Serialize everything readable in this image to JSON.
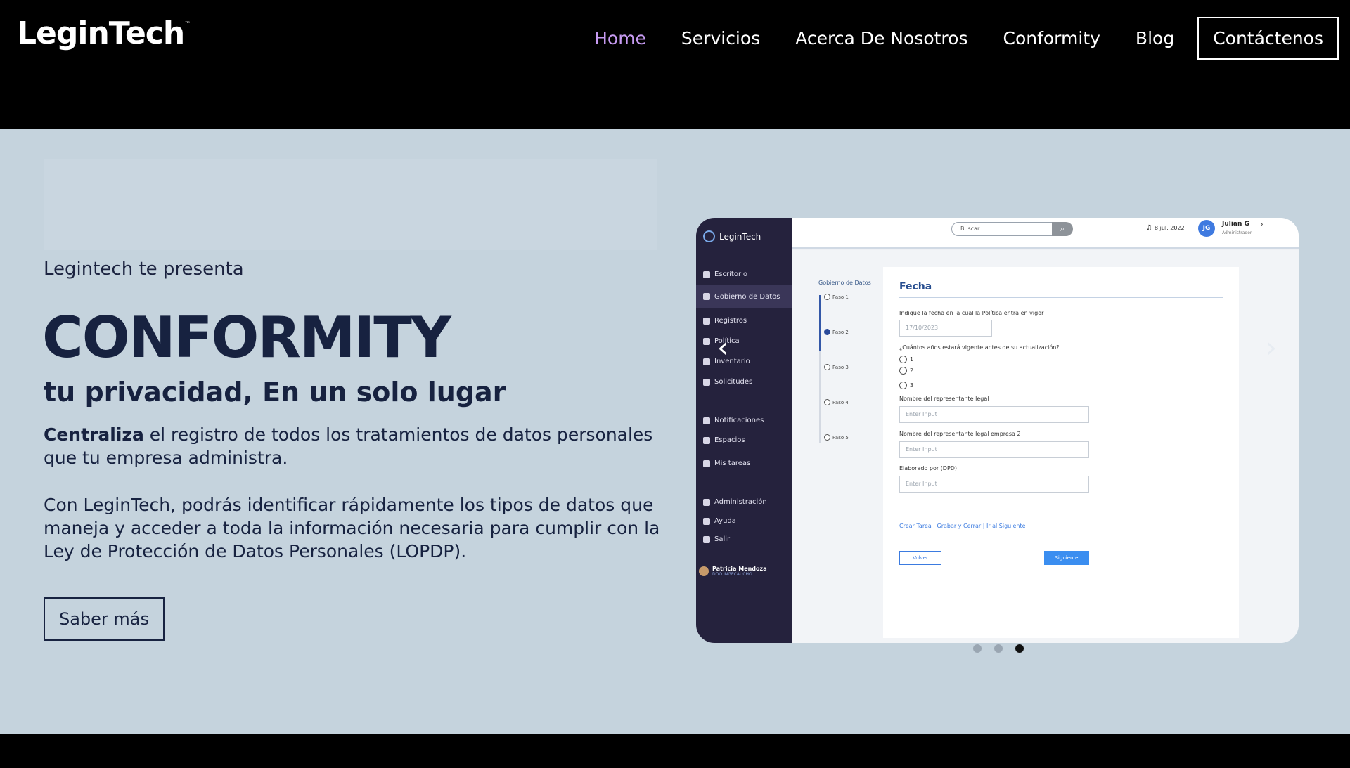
{
  "brand": {
    "logo_text": "LeginTech",
    "logo_mark": "™"
  },
  "nav": {
    "items": [
      {
        "label": "Home",
        "active": true
      },
      {
        "label": "Servicios",
        "active": false
      },
      {
        "label": "Acerca De Nosotros",
        "active": false
      },
      {
        "label": "Conformity",
        "active": false
      },
      {
        "label": "Blog",
        "active": false
      }
    ],
    "contact_label": "Contáctenos",
    "active_color": "#c79bf2"
  },
  "hero": {
    "intro": "Legintech te presenta",
    "title": "CONFORMITY",
    "subtitle_regular": "tu privacidad, ",
    "subtitle_bold": "En un solo lugar",
    "para1_bold": "Centraliza",
    "para1_rest": " el registro de todos los tratamientos de datos personales que tu empresa administra.",
    "para2": "Con LeginTech, podrás identificar rápidamente los tipos de datos que maneja y acceder a toda la información necesaria para cumplir con la Ley de Protección de Datos Personales (LOPDP).",
    "button_label": "Saber más",
    "background_color": "#c5d3dd",
    "text_color": "#172240"
  },
  "carousel": {
    "slide_count": 3,
    "active_index": 2,
    "prev_icon": "chevron-left-icon",
    "next_icon": "chevron-right-icon",
    "prev_glyph": "‹",
    "next_glyph": "›"
  },
  "mock_app": {
    "sidebar": {
      "logo": "LeginTech",
      "items": [
        {
          "label": "Escritorio",
          "icon": "desk-icon"
        },
        {
          "label": "Gobierno de Datos",
          "icon": "org-icon",
          "selected": true
        },
        {
          "label": "Registros",
          "icon": "file-icon"
        },
        {
          "label": "Política",
          "icon": "check-icon"
        },
        {
          "label": "Inventario",
          "icon": "inventory-icon"
        },
        {
          "label": "Solicitudes",
          "icon": "list-icon"
        },
        {
          "label": "Notificaciones",
          "icon": "bell-icon"
        },
        {
          "label": "Espacios",
          "icon": "org-icon"
        },
        {
          "label": "Mis tareas",
          "icon": "file-icon"
        },
        {
          "label": "Administración",
          "icon": "gear-icon"
        },
        {
          "label": "Ayuda",
          "icon": "help-icon"
        },
        {
          "label": "Salir",
          "icon": "exit-icon"
        }
      ],
      "user_name": "Patricia Mendoza",
      "user_role": "DOO INGECAUCHO"
    },
    "topbar": {
      "search_placeholder": "Buscar",
      "date": "8 jul. 2022",
      "avatar_initials": "JG",
      "user_name": "Julian G",
      "user_role": "Administrador"
    },
    "steps": {
      "title": "Gobierno de Datos",
      "items": [
        "Paso 1",
        "Paso 2",
        "Paso 3",
        "Paso 4",
        "Paso 5"
      ],
      "current": 1
    },
    "form": {
      "title": "Fecha",
      "q1": "Indique la fecha en la cual la Política entra en vigor",
      "date_value": "17/10/2023",
      "q2": "¿Cuántos años estará vigente antes de su actualización?",
      "options": [
        "1",
        "2",
        "3"
      ],
      "f1_label": "Nombre del representante legal",
      "f2_label": "Nombre del representante legal empresa 2",
      "f3_label": "Elaborado por (DPD)",
      "placeholder": "Enter Input",
      "links": "Crear Tarea | Grabar y Cerrar | Ir al Siguiente",
      "back_label": "Volver",
      "next_label": "Siguiente"
    }
  }
}
